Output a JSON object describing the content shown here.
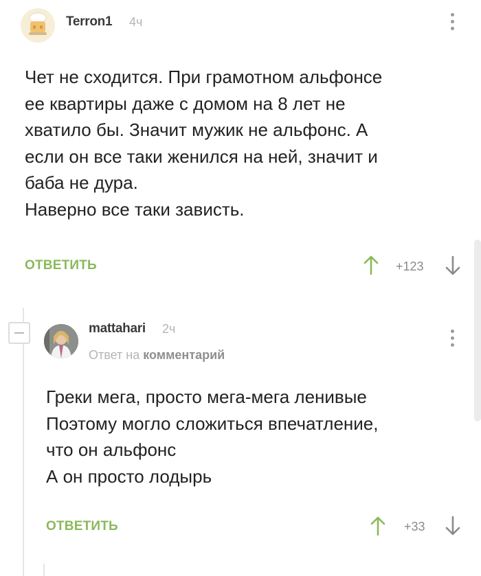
{
  "comment": {
    "author": "Terron1",
    "time": "4ч",
    "lines": [
      "Чет не сходится. При грамотном альфонсе",
      "ее квартиры даже с домом на 8 лет не",
      "хватило бы. Значит мужик не альфонс. А",
      "если он все таки женился на ней, значит и",
      "баба не дура.",
      "Наверно все таки зависть."
    ],
    "reply_label": "ОТВЕТИТЬ",
    "score": "+123"
  },
  "reply": {
    "author": "mattahari",
    "time": "2ч",
    "reply_to_prefix": "Ответ на",
    "reply_to_target": "комментарий",
    "lines": [
      "Греки мега, просто мега-мега ленивые",
      "Поэтому могло сложиться впечатление,",
      "что он альфонс",
      "А он просто лодырь"
    ],
    "reply_label": "ОТВЕТИТЬ",
    "score": "+33"
  },
  "colors": {
    "accent_green": "#8ab95a",
    "muted_text": "#b5b5b5",
    "body_text": "#222222"
  },
  "icons": {
    "options": "kebab-vertical-icon",
    "upvote": "arrow-up-icon",
    "downvote": "arrow-down-icon",
    "collapse": "minus-box-icon"
  }
}
